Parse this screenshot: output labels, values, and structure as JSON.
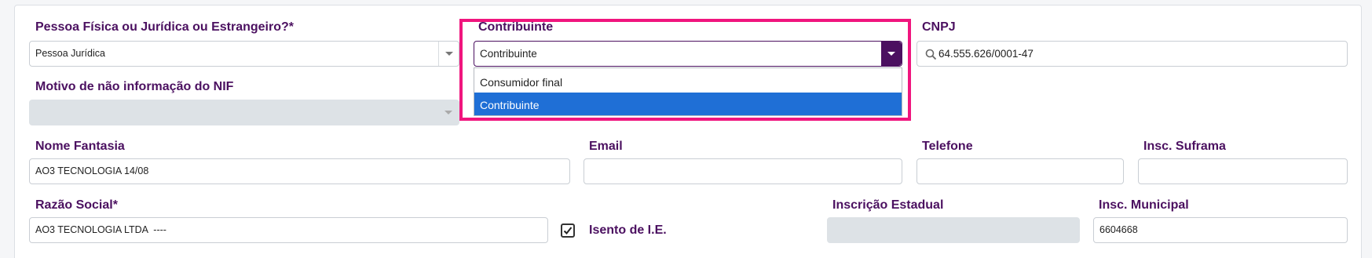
{
  "tipo_pessoa": {
    "label": "Pessoa Física ou Jurídica ou Estrangeiro?*",
    "value": "Pessoa Jurídica"
  },
  "contribuinte": {
    "label": "Contribuinte",
    "value": "Contribuinte",
    "options": [
      "Consumidor final",
      "Contribuinte"
    ],
    "selected_option": "Contribuinte"
  },
  "cnpj": {
    "label": "CNPJ",
    "value": "64.555.626/0001-47"
  },
  "motivo_nif": {
    "label": "Motivo de não informação do NIF",
    "value": ""
  },
  "nome_fantasia": {
    "label": "Nome Fantasia",
    "value": "AO3 TECNOLOGIA 14/08"
  },
  "email": {
    "label": "Email",
    "value": ""
  },
  "telefone": {
    "label": "Telefone",
    "value": ""
  },
  "insc_suframa": {
    "label": "Insc. Suframa",
    "value": ""
  },
  "razao_social": {
    "label": "Razão Social*",
    "value": "AO3 TECNOLOGIA LTDA  ----"
  },
  "isento_ie": {
    "label": "Isento de I.E.",
    "checked": true
  },
  "inscricao_estadual": {
    "label": "Inscrição Estadual",
    "value": ""
  },
  "insc_municipal": {
    "label": "Insc. Municipal",
    "value": "6604668"
  },
  "colors": {
    "label": "#4b1060",
    "highlight": "#f0157e",
    "selected_option": "#1f6fd6"
  }
}
